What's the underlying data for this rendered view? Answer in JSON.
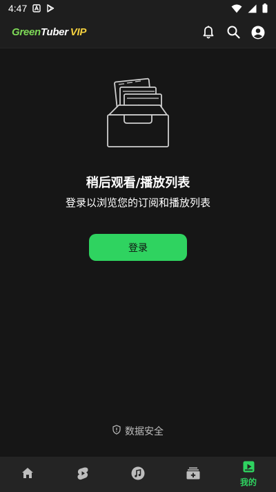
{
  "status_bar": {
    "time": "4:47",
    "icons": [
      "a-notification-icon",
      "play-store-icon",
      "wifi-icon",
      "signal-icon",
      "battery-icon"
    ]
  },
  "app_bar": {
    "logo": {
      "part1": "Green",
      "part2": "Tuber",
      "part3": "VIP"
    },
    "actions": [
      "bell-icon",
      "search-icon",
      "account-icon"
    ]
  },
  "main": {
    "title": "稍后观看/播放列表",
    "subtitle": "登录以浏览您的订阅和播放列表",
    "login_button": "登录",
    "data_safety": "数据安全"
  },
  "bottom_nav": {
    "items": [
      {
        "icon": "home-icon",
        "label": "",
        "active": false
      },
      {
        "icon": "shorts-icon",
        "label": "",
        "active": false
      },
      {
        "icon": "music-icon",
        "label": "",
        "active": false
      },
      {
        "icon": "subscriptions-icon",
        "label": "",
        "active": false
      },
      {
        "icon": "library-icon",
        "label": "我的",
        "active": true
      }
    ]
  },
  "colors": {
    "background": "#161616",
    "accent": "#2fd360",
    "logo_green": "#7ed957",
    "logo_vip": "#f4d03f"
  }
}
